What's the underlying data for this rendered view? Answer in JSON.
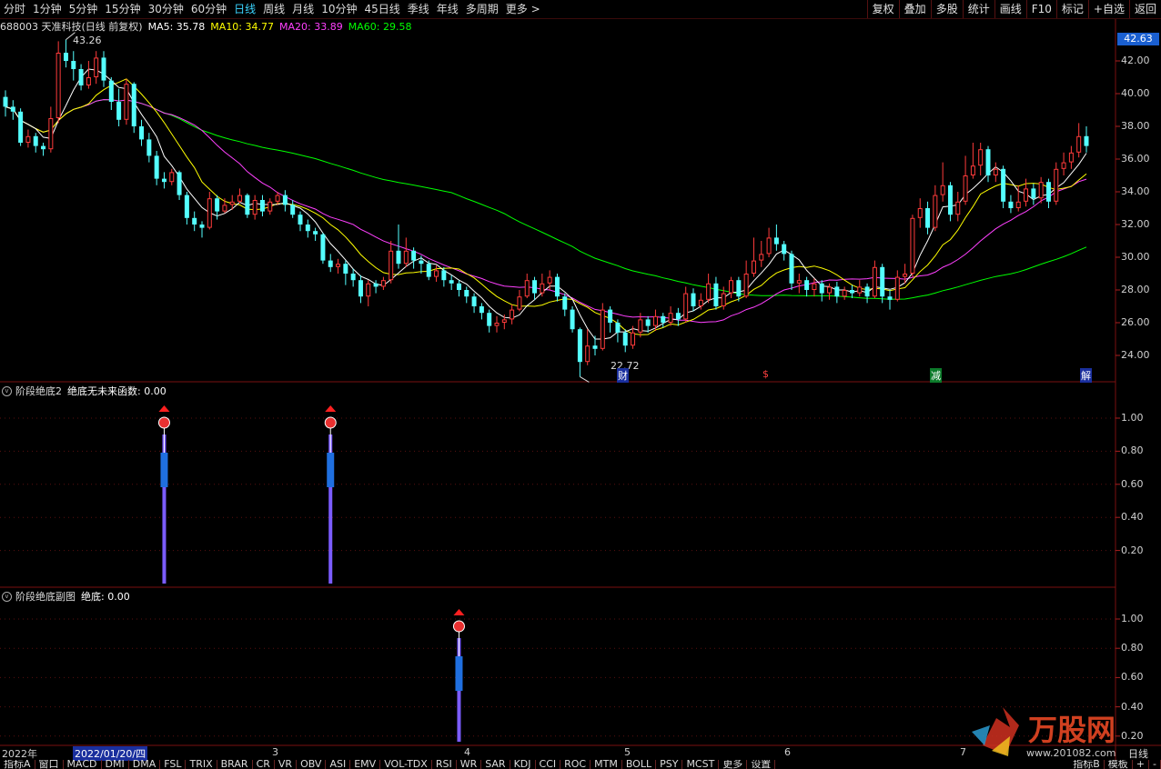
{
  "toolbar": {
    "periods": [
      "分时",
      "1分钟",
      "5分钟",
      "15分钟",
      "30分钟",
      "60分钟",
      "日线",
      "周线",
      "月线",
      "10分钟",
      "45日线",
      "季线",
      "年线",
      "多周期",
      "更多 >"
    ],
    "active_period": "日线",
    "right_tools": [
      "复权",
      "叠加",
      "多股",
      "统计",
      "画线",
      "F10",
      "标记",
      "+自选",
      "返回"
    ]
  },
  "stock": {
    "title": "688003 天准科技(日线 前复权)",
    "ma5_label": "MA5: 35.78",
    "ma10_label": "MA10: 34.77",
    "ma20_label": "MA20: 33.89",
    "ma60_label": "MA60: 29.58",
    "current_price": "42.63",
    "high_marker": "43.26",
    "low_marker": "22.72",
    "event_labels": [
      "财",
      "$",
      "减",
      "解"
    ]
  },
  "colors": {
    "up": "#ff3b3b",
    "down": "#54ffff",
    "ma5": "#ffffff",
    "ma10": "#ffff00",
    "ma20": "#ff40ff",
    "ma60": "#00ff00",
    "signal_bar": "#7b5cff",
    "signal_block": "#1f6fe0"
  },
  "price_axis": [
    "42.00",
    "40.00",
    "38.00",
    "36.00",
    "34.00",
    "32.00",
    "30.00",
    "28.00",
    "26.00",
    "24.00"
  ],
  "panel2": {
    "title": "阶段绝底2",
    "value_label": "绝底无未来函数: 0.00",
    "axis": [
      "1.00",
      "0.80",
      "0.60",
      "0.40",
      "0.20"
    ]
  },
  "panel3": {
    "title": "阶段绝底副图",
    "value_label": "绝底: 0.00",
    "axis": [
      "1.00",
      "0.80",
      "0.60",
      "0.40",
      "0.20"
    ]
  },
  "date_axis": {
    "labels": [
      "2022年",
      "2022/01/20/四",
      "3",
      "4",
      "5",
      "6",
      "7"
    ],
    "right_label": "日线"
  },
  "indicator_tabs": [
    "指标A",
    "窗口",
    "MACD",
    "DMI",
    "DMA",
    "FSL",
    "TRIX",
    "BRAR",
    "CR",
    "VR",
    "OBV",
    "ASI",
    "EMV",
    "VOL-TDX",
    "RSI",
    "WR",
    "SAR",
    "KDJ",
    "CCI",
    "ROC",
    "MTM",
    "BOLL",
    "PSY",
    "MCST",
    "更多",
    "设置"
  ],
  "indicator_right": [
    "指标B",
    "模板",
    "+",
    "-"
  ],
  "chart_data": {
    "type": "candlestick",
    "ylim": [
      22.5,
      43.5
    ],
    "candles": [
      [
        39.8,
        39.2,
        40.2,
        38.6
      ],
      [
        39.2,
        38.9,
        39.6,
        38.4
      ],
      [
        38.9,
        37.0,
        39.1,
        36.8
      ],
      [
        37.0,
        37.4,
        37.8,
        36.7
      ],
      [
        37.4,
        36.8,
        37.6,
        36.4
      ],
      [
        36.8,
        36.6,
        37.0,
        36.2
      ],
      [
        36.6,
        38.5,
        39.2,
        36.4
      ],
      [
        38.5,
        42.5,
        43.2,
        38.2
      ],
      [
        42.5,
        42.0,
        43.3,
        41.6
      ],
      [
        42.0,
        41.5,
        42.6,
        40.8
      ],
      [
        41.5,
        40.5,
        41.8,
        40.2
      ],
      [
        40.5,
        41.0,
        42.0,
        40.3
      ],
      [
        41.0,
        42.2,
        42.6,
        40.6
      ],
      [
        42.2,
        40.8,
        42.6,
        40.4
      ],
      [
        40.8,
        39.5,
        41.0,
        39.0
      ],
      [
        39.5,
        38.4,
        40.3,
        38.0
      ],
      [
        38.4,
        40.6,
        40.9,
        38.1
      ],
      [
        40.6,
        38.0,
        40.7,
        37.6
      ],
      [
        38.0,
        37.2,
        38.4,
        36.8
      ],
      [
        37.2,
        36.2,
        37.6,
        35.8
      ],
      [
        36.2,
        34.8,
        36.5,
        34.4
      ],
      [
        34.8,
        34.6,
        35.2,
        34.2
      ],
      [
        34.6,
        35.2,
        35.4,
        34.4
      ],
      [
        35.2,
        33.8,
        35.3,
        33.5
      ],
      [
        33.8,
        32.4,
        34.0,
        32.0
      ],
      [
        32.4,
        32.0,
        32.8,
        31.6
      ],
      [
        32.0,
        31.8,
        32.2,
        31.2
      ],
      [
        31.8,
        33.6,
        34.0,
        31.7
      ],
      [
        33.6,
        32.8,
        33.8,
        32.3
      ],
      [
        32.8,
        33.2,
        33.6,
        32.7
      ],
      [
        33.2,
        33.4,
        33.8,
        32.9
      ],
      [
        33.4,
        33.8,
        34.2,
        33.3
      ],
      [
        33.8,
        32.6,
        33.9,
        32.4
      ],
      [
        32.6,
        33.5,
        33.8,
        32.3
      ],
      [
        33.5,
        32.8,
        33.8,
        32.5
      ],
      [
        32.8,
        33.4,
        33.6,
        32.6
      ],
      [
        33.4,
        33.8,
        34.0,
        33.2
      ],
      [
        33.8,
        33.2,
        34.1,
        32.8
      ],
      [
        33.2,
        32.6,
        33.5,
        32.4
      ],
      [
        32.6,
        32.0,
        32.8,
        31.6
      ],
      [
        32.0,
        31.6,
        32.3,
        31.2
      ],
      [
        31.6,
        31.4,
        31.8,
        31.0
      ],
      [
        31.4,
        29.8,
        31.5,
        29.6
      ],
      [
        29.8,
        29.4,
        30.2,
        29.1
      ],
      [
        29.4,
        29.6,
        29.9,
        29.0
      ],
      [
        29.6,
        29.0,
        29.8,
        28.3
      ],
      [
        29.0,
        28.6,
        29.3,
        28.2
      ],
      [
        28.6,
        27.6,
        28.9,
        27.2
      ],
      [
        27.6,
        28.4,
        28.6,
        27.0
      ],
      [
        28.4,
        28.2,
        28.6,
        27.8
      ],
      [
        28.2,
        28.6,
        28.8,
        28.0
      ],
      [
        28.6,
        30.4,
        31.0,
        28.4
      ],
      [
        30.4,
        29.6,
        32.0,
        29.3
      ],
      [
        29.6,
        30.4,
        31.2,
        29.4
      ],
      [
        30.4,
        29.8,
        30.6,
        29.3
      ],
      [
        29.8,
        29.6,
        30.1,
        29.0
      ],
      [
        29.6,
        28.8,
        29.8,
        28.6
      ],
      [
        28.8,
        29.2,
        29.5,
        28.5
      ],
      [
        29.2,
        28.6,
        29.4,
        28.2
      ],
      [
        28.6,
        28.4,
        28.9,
        28.0
      ],
      [
        28.4,
        28.0,
        28.6,
        27.6
      ],
      [
        28.0,
        27.6,
        28.2,
        27.2
      ],
      [
        27.6,
        27.0,
        27.8,
        26.6
      ],
      [
        27.0,
        26.6,
        27.2,
        26.2
      ],
      [
        26.6,
        25.8,
        26.8,
        25.4
      ],
      [
        25.8,
        26.0,
        26.4,
        25.4
      ],
      [
        26.0,
        26.2,
        26.5,
        25.6
      ],
      [
        26.2,
        26.8,
        27.1,
        25.9
      ],
      [
        26.8,
        27.6,
        28.0,
        26.7
      ],
      [
        27.6,
        28.6,
        29.0,
        27.5
      ],
      [
        28.6,
        27.8,
        28.8,
        27.4
      ],
      [
        27.8,
        28.4,
        29.0,
        27.6
      ],
      [
        28.4,
        28.8,
        29.2,
        28.0
      ],
      [
        28.8,
        27.6,
        29.0,
        27.3
      ],
      [
        27.6,
        26.8,
        27.8,
        26.4
      ],
      [
        26.8,
        25.6,
        27.0,
        25.4
      ],
      [
        25.6,
        23.6,
        25.7,
        22.7
      ],
      [
        23.6,
        24.6,
        25.6,
        23.4
      ],
      [
        24.6,
        24.4,
        25.2,
        24.0
      ],
      [
        24.4,
        26.8,
        27.2,
        24.3
      ],
      [
        26.8,
        26.0,
        27.0,
        25.4
      ],
      [
        26.0,
        25.4,
        26.2,
        24.8
      ],
      [
        25.4,
        24.6,
        25.6,
        24.2
      ],
      [
        24.6,
        25.4,
        25.8,
        24.4
      ],
      [
        25.4,
        26.2,
        26.6,
        25.1
      ],
      [
        26.2,
        25.8,
        26.4,
        25.4
      ],
      [
        25.8,
        26.4,
        26.8,
        25.5
      ],
      [
        26.4,
        26.0,
        26.6,
        25.7
      ],
      [
        26.0,
        26.6,
        27.0,
        25.8
      ],
      [
        26.6,
        26.2,
        26.9,
        25.8
      ],
      [
        26.2,
        27.8,
        28.2,
        26.0
      ],
      [
        27.8,
        27.0,
        28.1,
        26.7
      ],
      [
        27.0,
        27.4,
        27.8,
        26.8
      ],
      [
        27.4,
        28.4,
        29.0,
        27.2
      ],
      [
        28.4,
        27.0,
        28.8,
        26.8
      ],
      [
        27.0,
        27.8,
        28.2,
        26.8
      ],
      [
        27.8,
        28.6,
        28.8,
        27.5
      ],
      [
        28.6,
        27.6,
        28.8,
        27.3
      ],
      [
        27.6,
        29.0,
        29.8,
        27.5
      ],
      [
        29.0,
        29.8,
        31.2,
        28.8
      ],
      [
        29.8,
        30.2,
        31.0,
        29.4
      ],
      [
        30.2,
        31.2,
        31.8,
        30.0
      ],
      [
        31.2,
        30.8,
        32.0,
        30.4
      ],
      [
        30.8,
        30.2,
        31.0,
        29.8
      ],
      [
        30.2,
        28.4,
        30.4,
        28.0
      ],
      [
        28.4,
        28.6,
        29.0,
        27.8
      ],
      [
        28.6,
        28.0,
        28.8,
        27.6
      ],
      [
        28.0,
        28.4,
        28.7,
        27.6
      ],
      [
        28.4,
        27.8,
        28.6,
        27.3
      ],
      [
        27.8,
        28.2,
        28.4,
        27.4
      ],
      [
        28.2,
        27.6,
        28.5,
        27.2
      ],
      [
        27.6,
        28.0,
        28.2,
        27.4
      ],
      [
        28.0,
        27.8,
        28.3,
        27.5
      ],
      [
        27.8,
        28.2,
        28.6,
        27.6
      ],
      [
        28.2,
        27.6,
        28.4,
        27.2
      ],
      [
        27.6,
        29.4,
        29.8,
        27.5
      ],
      [
        29.4,
        27.6,
        29.6,
        27.2
      ],
      [
        27.6,
        27.4,
        28.0,
        26.8
      ],
      [
        27.4,
        28.8,
        29.2,
        27.3
      ],
      [
        28.8,
        29.0,
        29.6,
        28.4
      ],
      [
        29.0,
        32.4,
        32.6,
        28.8
      ],
      [
        32.4,
        33.0,
        33.6,
        31.8
      ],
      [
        33.0,
        31.8,
        33.4,
        31.4
      ],
      [
        31.8,
        33.8,
        34.4,
        31.6
      ],
      [
        33.8,
        34.4,
        35.8,
        33.4
      ],
      [
        34.4,
        32.6,
        34.6,
        32.2
      ],
      [
        32.6,
        33.4,
        34.0,
        32.2
      ],
      [
        33.4,
        35.0,
        36.2,
        33.2
      ],
      [
        35.0,
        35.6,
        37.0,
        34.8
      ],
      [
        35.6,
        36.6,
        37.0,
        35.0
      ],
      [
        36.6,
        35.0,
        36.8,
        34.6
      ],
      [
        35.0,
        35.4,
        35.8,
        34.6
      ],
      [
        35.4,
        33.4,
        35.6,
        33.0
      ],
      [
        33.4,
        33.0,
        33.8,
        32.7
      ],
      [
        33.0,
        33.4,
        34.4,
        32.8
      ],
      [
        33.4,
        34.2,
        34.8,
        33.1
      ],
      [
        34.2,
        33.6,
        34.5,
        33.2
      ],
      [
        33.6,
        34.6,
        34.9,
        33.3
      ],
      [
        34.6,
        33.4,
        34.8,
        33.0
      ],
      [
        33.4,
        35.4,
        35.8,
        33.2
      ],
      [
        35.4,
        35.8,
        36.4,
        35.0
      ],
      [
        35.8,
        36.4,
        36.8,
        35.4
      ],
      [
        36.4,
        37.4,
        38.2,
        36.1
      ],
      [
        37.4,
        36.8,
        38.0,
        36.4
      ]
    ]
  }
}
